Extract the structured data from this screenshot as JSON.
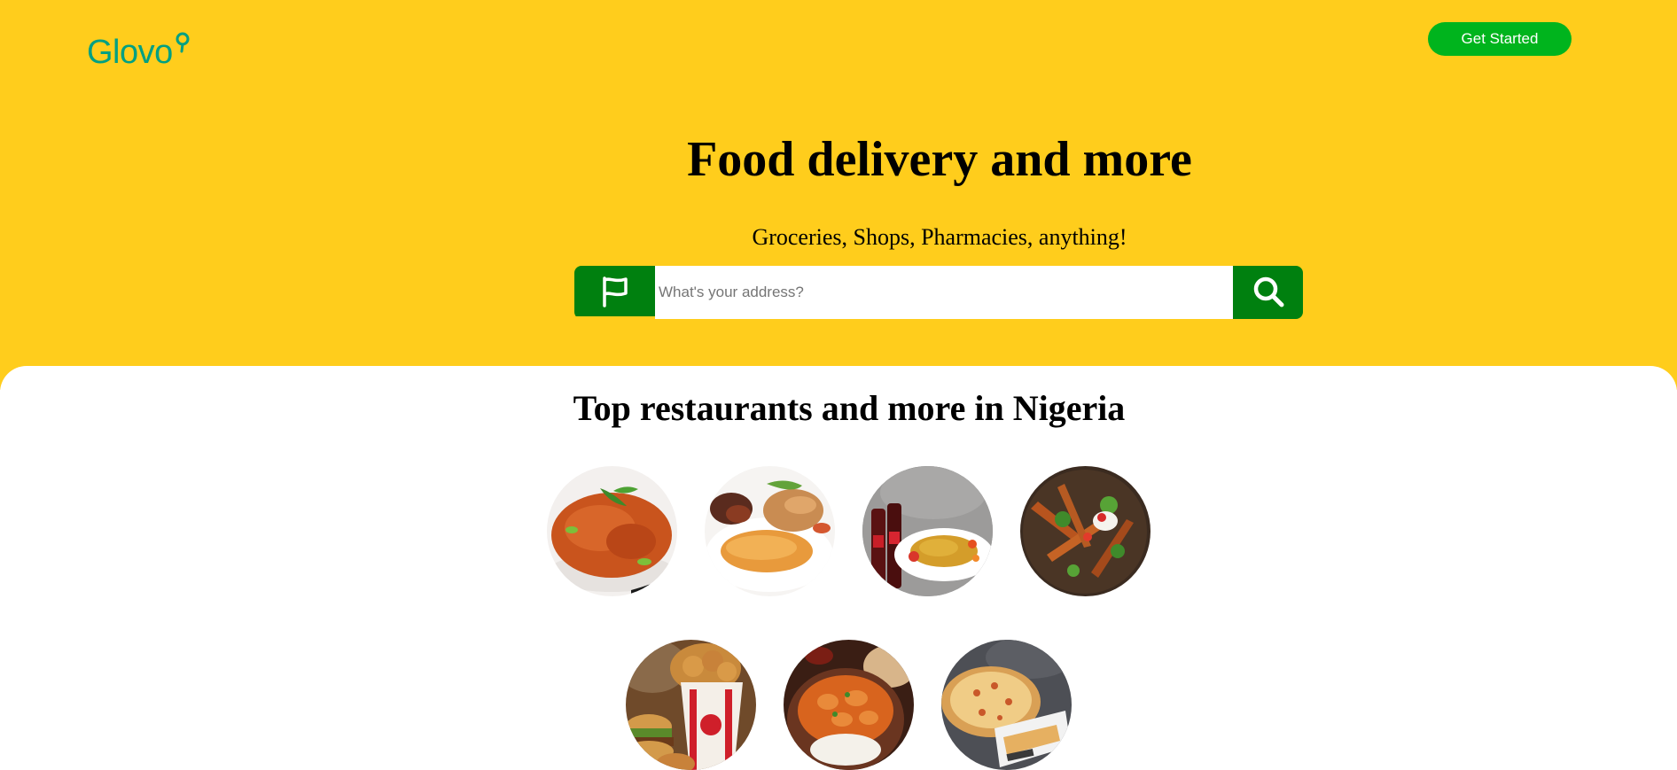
{
  "brand": {
    "name": "Glovo",
    "color": "#00A082"
  },
  "header": {
    "cta_label": "Get Started",
    "cta_color": "#00B41D"
  },
  "hero": {
    "background": "#FFCD1C",
    "title": "Food delivery and more",
    "subtitle": "Groceries, Shops, Pharmacies, anything!"
  },
  "search": {
    "placeholder": "What's your address?",
    "flag_icon": "flag-icon",
    "search_icon": "search-icon",
    "button_color": "#00800F"
  },
  "restaurants": {
    "title": "Top restaurants and more in Nigeria",
    "items": [
      {
        "name": "jollof-rice"
      },
      {
        "name": "rice-chicken-plate"
      },
      {
        "name": "jollof-with-coke"
      },
      {
        "name": "salad-plantain"
      },
      {
        "name": "kfc-bucket"
      },
      {
        "name": "curry-rice"
      },
      {
        "name": "pizza"
      }
    ]
  }
}
